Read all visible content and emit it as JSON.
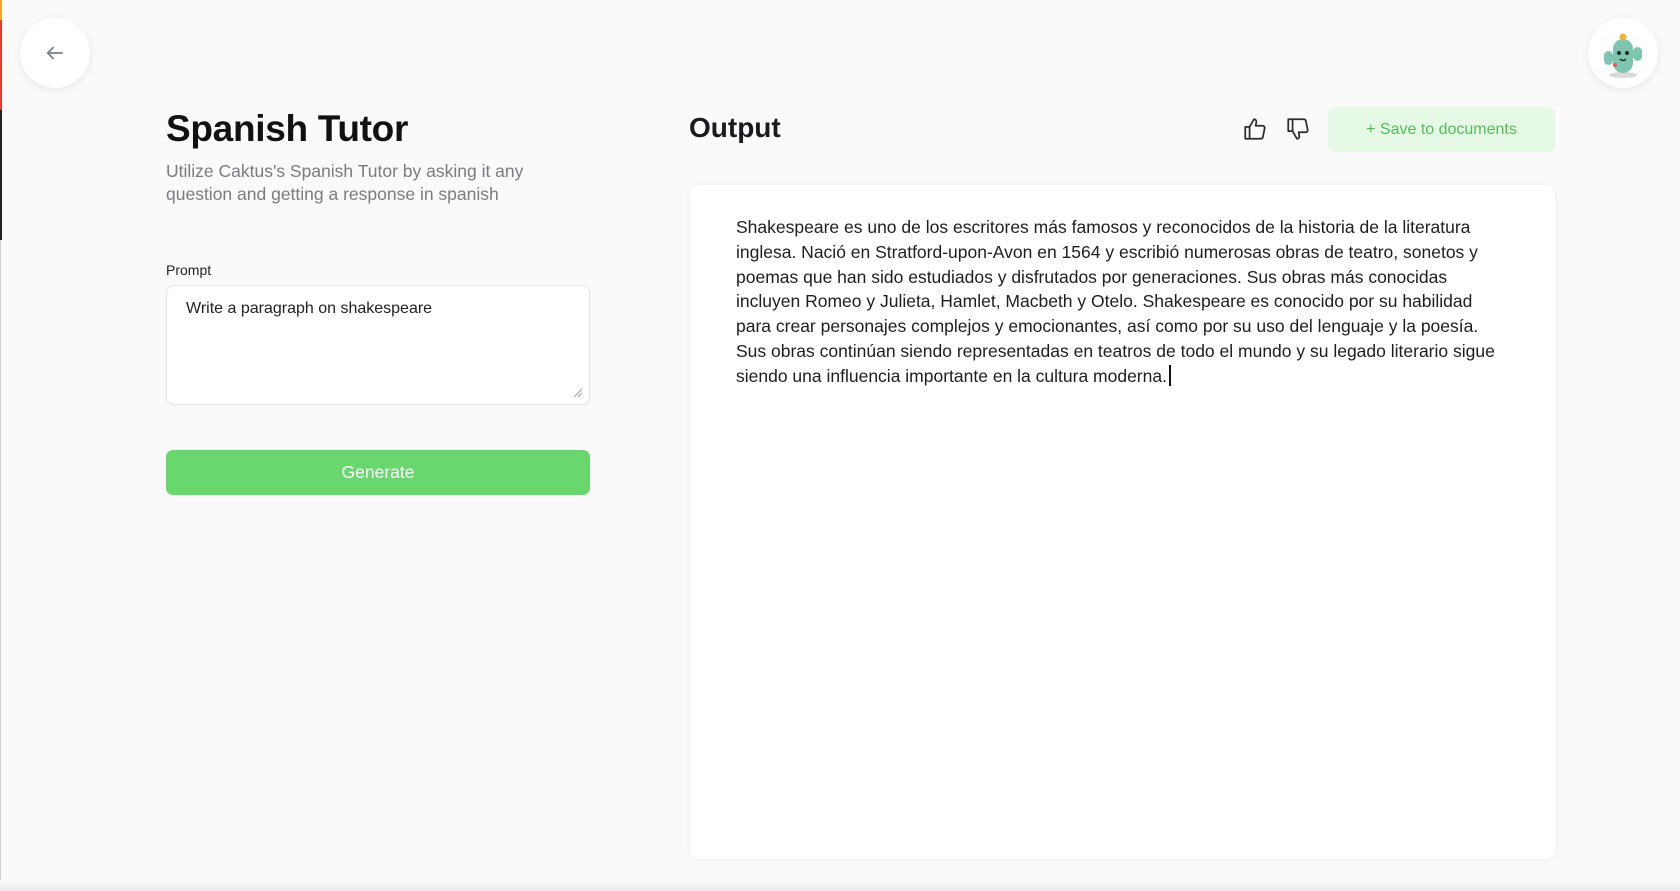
{
  "header": {
    "back_icon": "arrow-left-icon",
    "avatar_icon": "cactus-avatar-icon"
  },
  "tool": {
    "title": "Spanish Tutor",
    "subtitle": "Utilize Caktus's Spanish Tutor by asking it any question and getting a response in spanish",
    "prompt_label": "Prompt",
    "prompt_value": "Write a paragraph on shakespeare",
    "generate_label": "Generate"
  },
  "output": {
    "title": "Output",
    "save_label": "+ Save to documents",
    "text": "Shakespeare es uno de los escritores más famosos y reconocidos de la historia de la literatura inglesa. Nació en Stratford-upon-Avon en 1564 y escribió numerosas obras de teatro, sonetos y poemas que han sido estudiados y disfrutados por generaciones. Sus obras más conocidas incluyen Romeo y Julieta, Hamlet, Macbeth y Otelo. Shakespeare es conocido por su habilidad para crear personajes complejos y emocionantes, así como por su uso del lenguaje y la poesía. Sus obras continúan siendo representadas en teatros de todo el mundo y su legado literario sigue siendo una influencia importante en la cultura moderna."
  },
  "colors": {
    "accent_green": "#68d76d",
    "save_bg": "#e6f9e6",
    "save_text": "#4fbf55"
  }
}
